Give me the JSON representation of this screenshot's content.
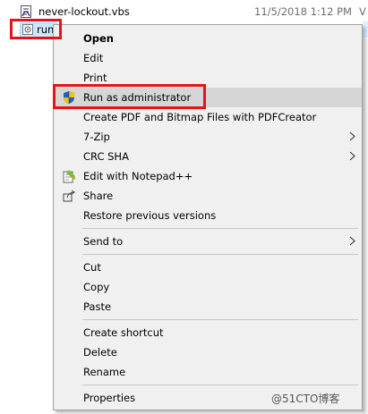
{
  "files": [
    {
      "name": "never-lockout.vbs",
      "date": "11/5/2018 1:12 PM",
      "type": "V",
      "icon": "vbs-script-icon"
    },
    {
      "name": "run",
      "icon": "shortcut-file-icon"
    }
  ],
  "menu": {
    "items": [
      {
        "label": "Open"
      },
      {
        "label": "Edit"
      },
      {
        "label": "Print"
      },
      {
        "label": "Run as administrator",
        "icon": "uac-shield-icon"
      },
      {
        "label": "Create PDF and Bitmap Files with PDFCreator"
      },
      {
        "label": "7-Zip"
      },
      {
        "label": "CRC SHA"
      },
      {
        "label": "Edit with Notepad++",
        "icon": "notepad-plus-plus-icon"
      },
      {
        "label": "Share",
        "icon": "share-icon"
      },
      {
        "label": "Restore previous versions"
      },
      {
        "label": "Send to"
      },
      {
        "label": "Cut"
      },
      {
        "label": "Copy"
      },
      {
        "label": "Paste"
      },
      {
        "label": "Create shortcut"
      },
      {
        "label": "Delete"
      },
      {
        "label": "Rename"
      },
      {
        "label": "Properties"
      }
    ]
  },
  "watermark": "@51CTO博客",
  "colors": {
    "highlight_box": "#e4141b",
    "selection": "#cce8ff",
    "menu_bg": "#f0f0f0"
  }
}
